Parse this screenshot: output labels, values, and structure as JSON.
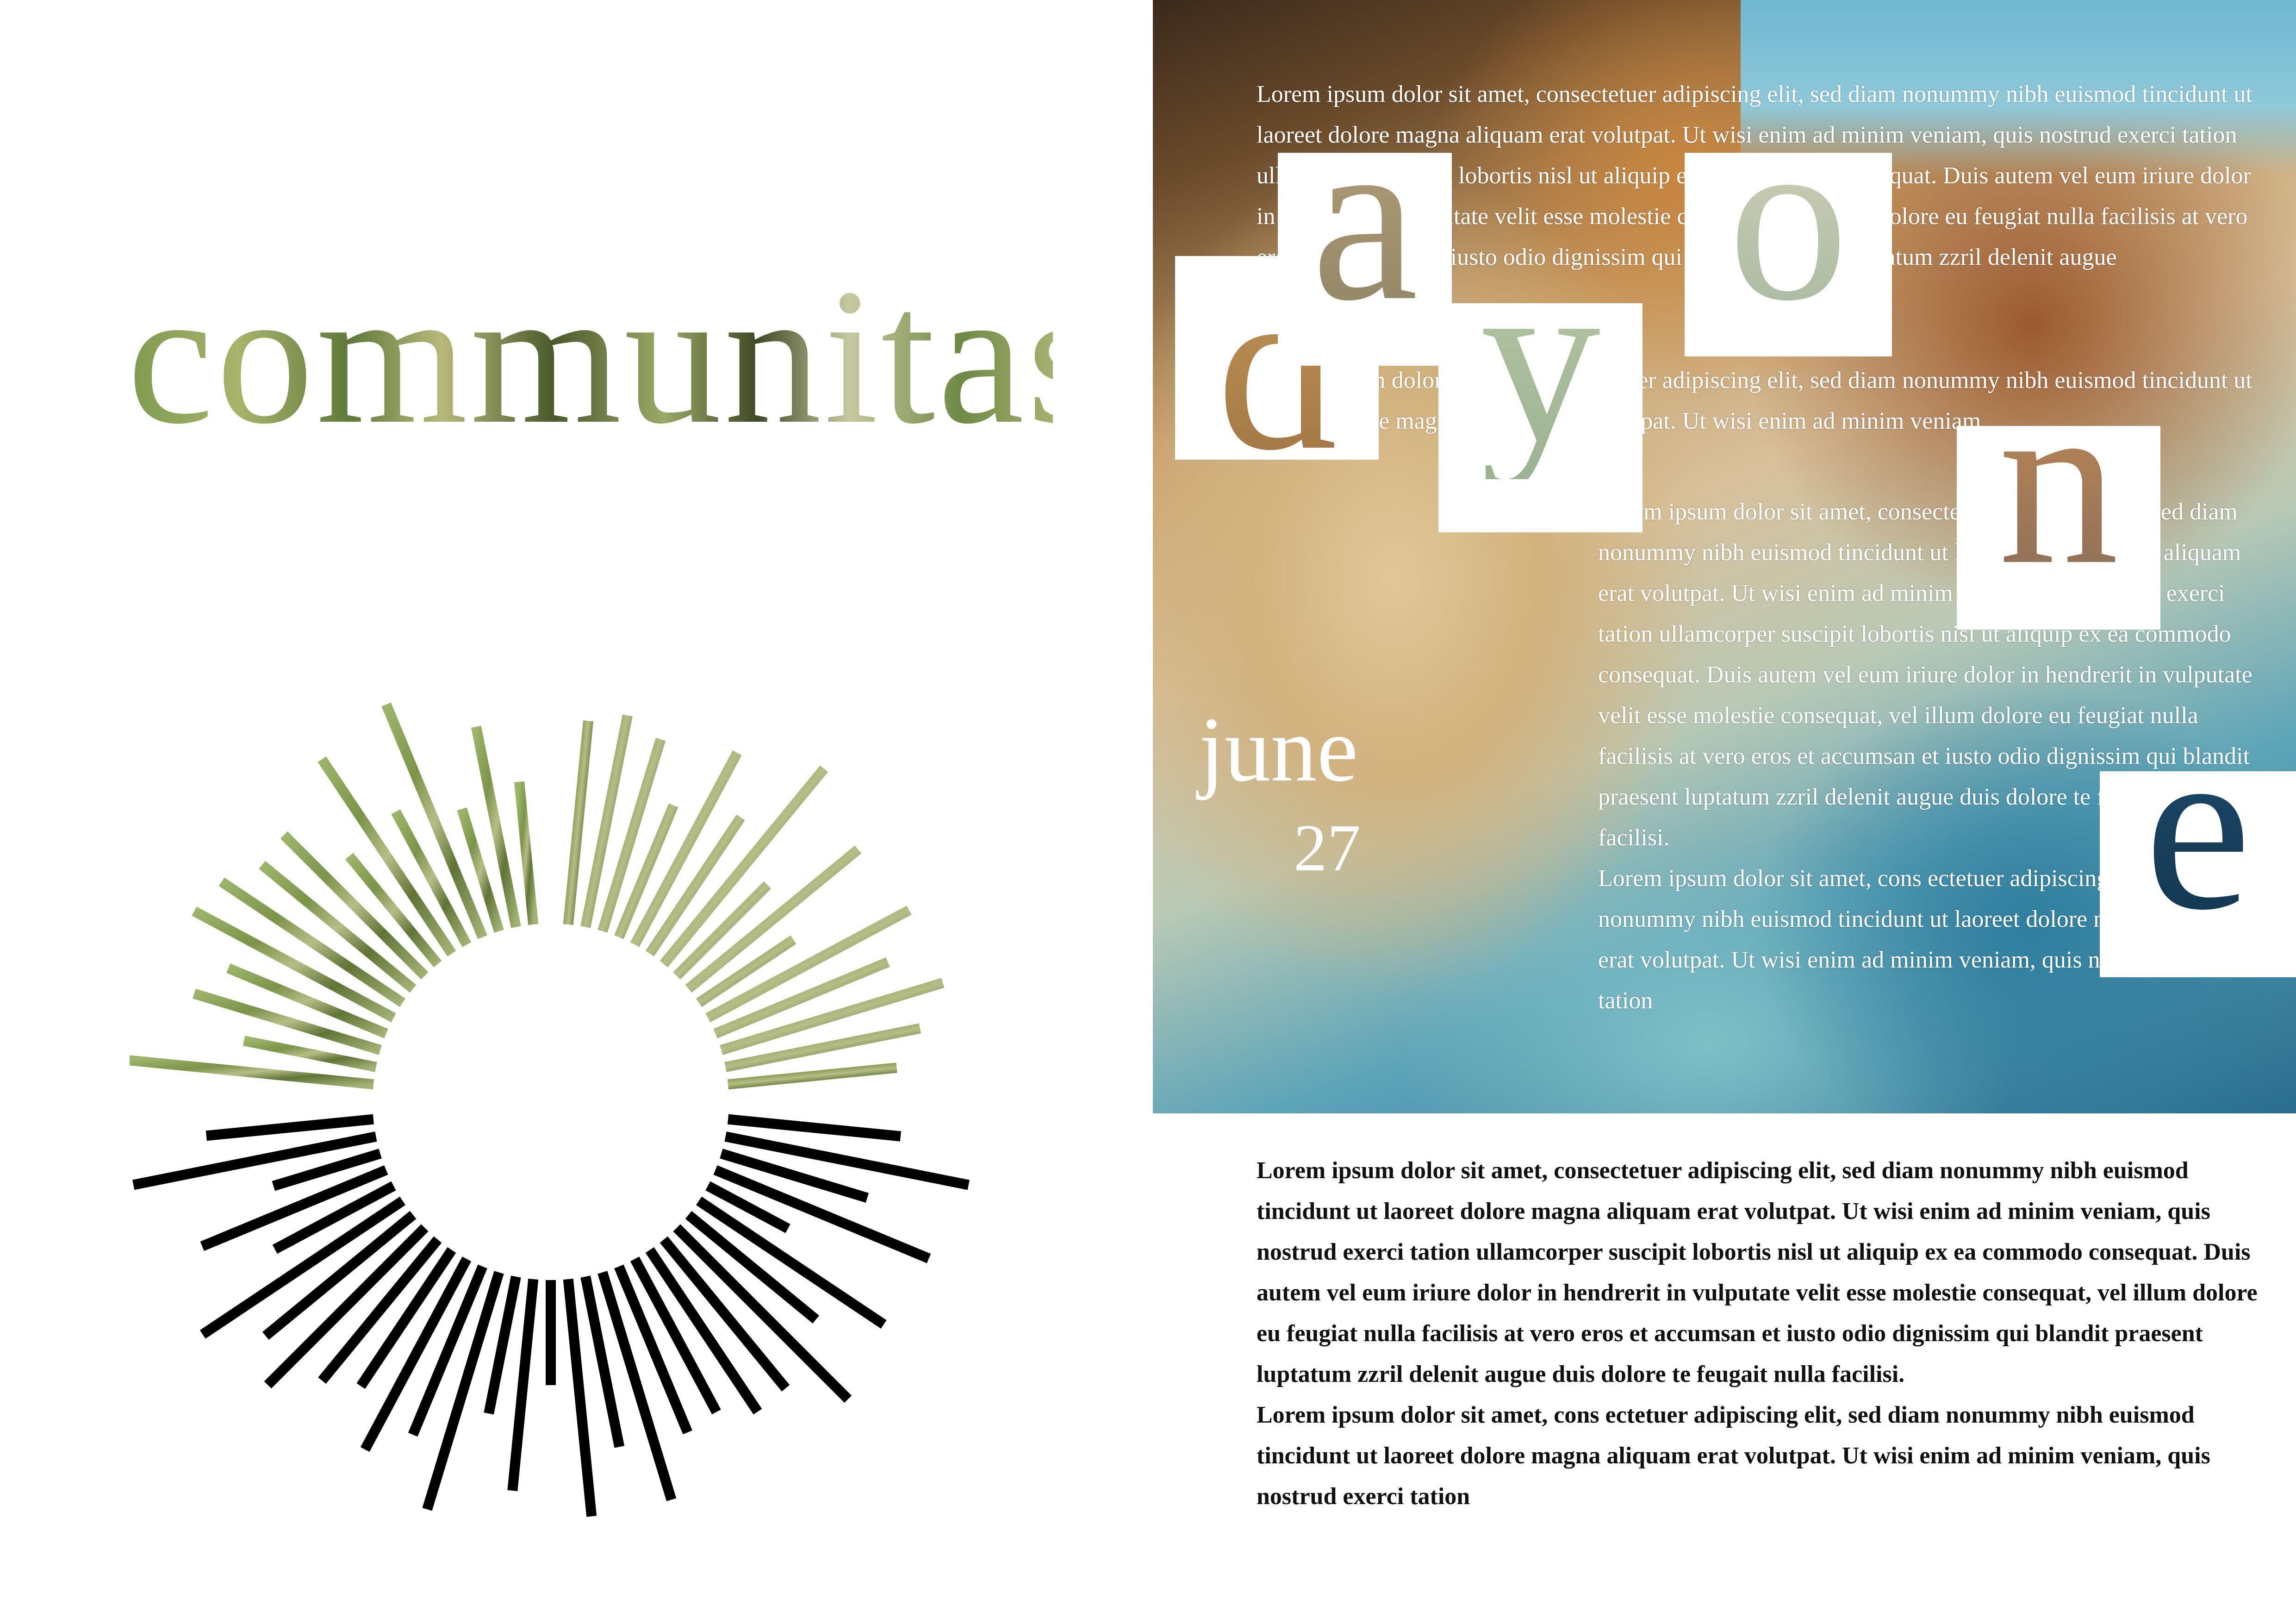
{
  "left_page": {
    "title": "communitas"
  },
  "right_page": {
    "letters": [
      "d",
      "a",
      "y",
      "o",
      "n",
      "e"
    ],
    "date": {
      "month": "june",
      "day": "27"
    },
    "photo_text": {
      "block1": "Lorem ipsum dolor sit amet, consectetuer adipiscing elit, sed diam nonummy nibh euismod tincidunt ut laoreet dolore magna aliquam erat volutpat. Ut wisi enim ad minim veniam, quis nostrud exerci tation ullamcorper suscipit lobortis nisl ut aliquip ex ea commodo consequat. Duis autem vel eum iriure dolor in hendrerit in vulputate velit esse molestie consequat, vel illum dolore eu feugiat nulla facilisis at vero eros et accumsan et iusto odio dignissim qui blandit praesent luptatum zzril delenit augue",
      "block2": "Lorem ipsum dolor sit amet, consectetuer adipiscing elit, sed diam nonummy nibh euismod tincidunt ut laoreet dolore magna aliquam erat volutpat. Ut wisi enim ad minim veniam,",
      "block3": "Lorem ipsum dolor sit amet, consectetuer adipiscing elit, sed diam nonummy nibh euismod tincidunt ut laoreet dolore magna aliquam erat volutpat. Ut wisi enim ad minim veniam, quis nostrud exerci tation ullamcorper suscipit lobortis nisl ut aliquip ex ea commodo consequat. Duis autem vel eum iriure dolor in hendrerit in vulputate velit esse molestie consequat, vel illum dolore eu feugiat nulla facilisis at vero eros et accumsan et iusto odio dignissim qui blandit praesent luptatum zzril delenit augue duis dolore te feugait nulla facilisi.",
      "block4": "Lorem ipsum dolor sit amet, cons ectetuer adipiscing elit, sed diam nonummy nibh euismod tincidunt ut laoreet dolore magna aliquam erat volutpat. Ut wisi enim ad minim veniam, quis nostrud exerci tation"
    },
    "body_text": {
      "para1": "Lorem ipsum dolor sit amet, consectetuer adipiscing elit, sed diam nonummy nibh euismod tincidunt ut laoreet dolore magna aliquam erat volutpat. Ut wisi enim ad minim veniam, quis nostrud exerci tation ullamcorper suscipit lobortis nisl ut aliquip ex ea commodo consequat. Duis autem vel eum iriure dolor in hendrerit in vulputate velit esse molestie consequat, vel illum dolore eu feugiat nulla facilisis at vero eros et accumsan et iusto odio dignissim qui blandit praesent luptatum zzril delenit augue duis dolore te feugait nulla facilisi.",
      "para2": "Lorem ipsum dolor sit amet, cons ectetuer adipiscing elit, sed diam nonummy nibh euismod tincidunt ut laoreet dolore magna aliquam erat volutpat. Ut wisi enim ad minim veniam, quis nostrud exerci tation"
    }
  },
  "colors": {
    "grass_green": "#8fa65a",
    "dark_green": "#4b5a2c",
    "black_rays": "#000000",
    "photo_teal": "#2f7fa0",
    "photo_tan": "#d2b27e",
    "navy_letter": "#123650"
  }
}
